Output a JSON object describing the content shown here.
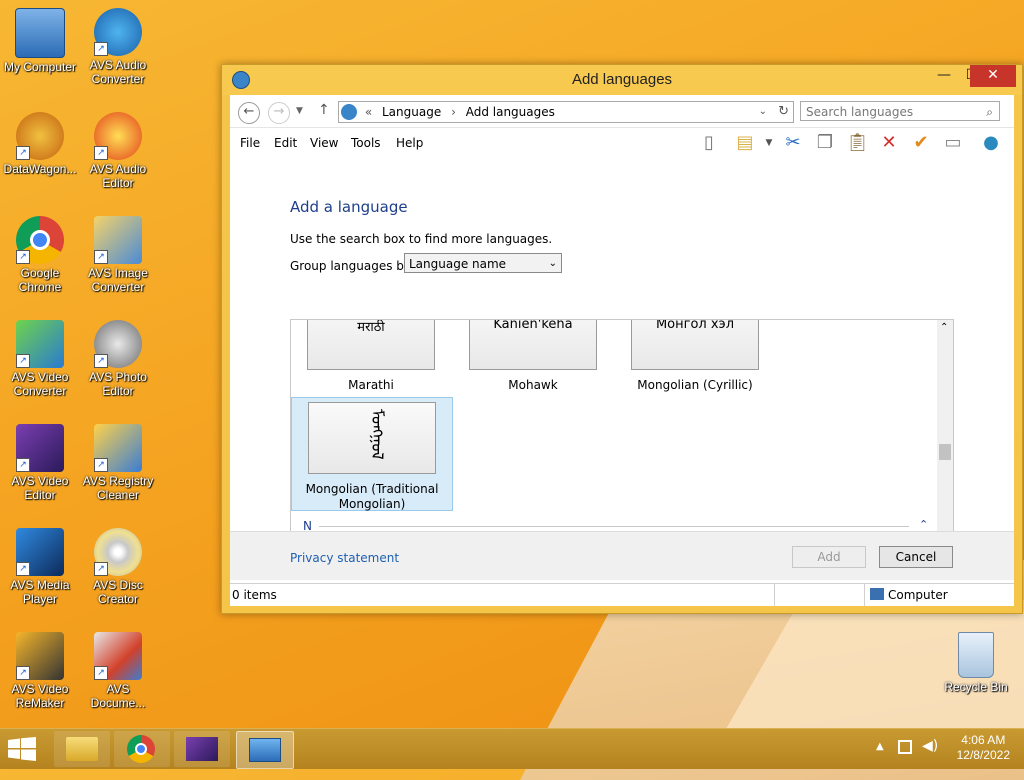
{
  "desktop": {
    "icons": [
      {
        "label": "My Computer"
      },
      {
        "label": "AVS Audio Converter"
      },
      {
        "label": "DataWagon..."
      },
      {
        "label": "AVS Audio Editor"
      },
      {
        "label": "Google Chrome"
      },
      {
        "label": "AVS Image Converter"
      },
      {
        "label": "AVS Video Converter"
      },
      {
        "label": "AVS Photo Editor"
      },
      {
        "label": "AVS Video Editor"
      },
      {
        "label": "AVS Registry Cleaner"
      },
      {
        "label": "AVS Media Player"
      },
      {
        "label": "AVS Disc Creator"
      },
      {
        "label": "AVS Video ReMaker"
      },
      {
        "label": "AVS Docume..."
      },
      {
        "label": "Recycle Bin"
      }
    ]
  },
  "window": {
    "title": "Add languages",
    "address": {
      "prefix": "«",
      "part1": "Language",
      "sep": "›",
      "part2": "Add languages"
    },
    "search_placeholder": "Search languages",
    "menu": [
      "File",
      "Edit",
      "View",
      "Tools",
      "Help"
    ],
    "heading": "Add a language",
    "hint": "Use the search box to find more languages.",
    "group_label": "Group languages by:",
    "group_value": "Language name",
    "tiles": [
      {
        "native": "मराठी",
        "name": "Marathi"
      },
      {
        "native": "Kanien'kéha",
        "name": "Mohawk"
      },
      {
        "native": "Монгол хэл",
        "name": "Mongolian (Cyrillic)"
      },
      {
        "native": "ᠮᠣᠩᠭᠣᠯ",
        "name": "Mongolian (Traditional Mongolian)"
      }
    ],
    "group_letter": "N",
    "privacy": "Privacy statement",
    "add_label": "Add",
    "cancel_label": "Cancel",
    "status_items": "0 items",
    "status_computer": "Computer"
  },
  "taskbar": {
    "time": "4:06 AM",
    "date": "12/8/2022"
  }
}
